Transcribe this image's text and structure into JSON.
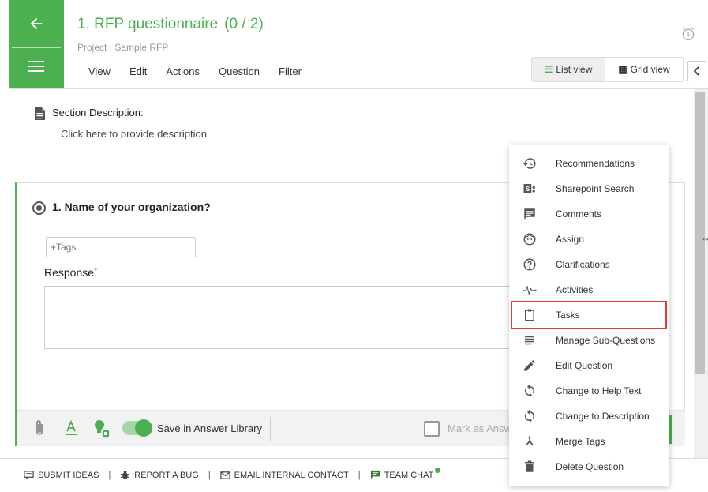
{
  "header": {
    "title": "1. RFP questionnaire",
    "count": "(0 / 2)",
    "project": "Project : Sample RFP"
  },
  "menubar": [
    "View",
    "Edit",
    "Actions",
    "Question",
    "Filter"
  ],
  "view_toggle": {
    "list_label": "List view",
    "grid_label": "Grid view"
  },
  "section": {
    "label": "Section Description:",
    "placeholder": "Click here to provide description"
  },
  "question": {
    "title": "1. Name of your organization?",
    "tags_placeholder": "+Tags",
    "response_label": "Response",
    "required_mark": "*"
  },
  "toolbar": {
    "save_in_library": "Save in Answer Library",
    "mark_as_answered": "Mark as Answ"
  },
  "footer": {
    "submit_ideas": "SUBMIT IDEAS",
    "report_bug": "REPORT A BUG",
    "email_contact": "EMAIL INTERNAL CONTACT",
    "team_chat": "TEAM CHAT",
    "separator": "|"
  },
  "context_menu": {
    "items": [
      {
        "label": "Recommendations",
        "icon": "history-icon"
      },
      {
        "label": "Sharepoint Search",
        "icon": "sharepoint-icon"
      },
      {
        "label": "Comments",
        "icon": "comment-icon"
      },
      {
        "label": "Assign",
        "icon": "face-icon"
      },
      {
        "label": "Clarifications",
        "icon": "help-circle-icon"
      },
      {
        "label": "Activities",
        "icon": "pulse-icon"
      },
      {
        "label": "Tasks",
        "icon": "clipboard-icon"
      },
      {
        "label": "Manage Sub-Questions",
        "icon": "lines-icon"
      },
      {
        "label": "Edit Question",
        "icon": "pencil-icon"
      },
      {
        "label": "Change to Help Text",
        "icon": "sync-icon"
      },
      {
        "label": "Change to Description",
        "icon": "sync-icon"
      },
      {
        "label": "Merge Tags",
        "icon": "merge-icon"
      },
      {
        "label": "Delete Question",
        "icon": "trash-icon"
      }
    ],
    "highlighted": "Tasks"
  },
  "colors": {
    "brand_green": "#4caf50",
    "highlight_red": "#e53935"
  }
}
